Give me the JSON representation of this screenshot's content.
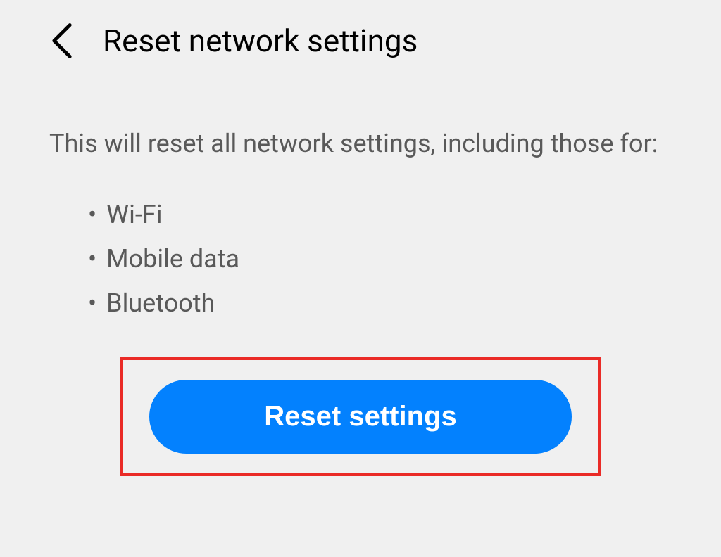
{
  "header": {
    "title": "Reset network settings"
  },
  "description": "This will reset all network settings, including those for:",
  "bullets": {
    "item0": "Wi-Fi",
    "item1": "Mobile data",
    "item2": "Bluetooth"
  },
  "button": {
    "reset_label": "Reset settings"
  },
  "colors": {
    "accent": "#0381fe",
    "highlight": "#ea2b27"
  }
}
